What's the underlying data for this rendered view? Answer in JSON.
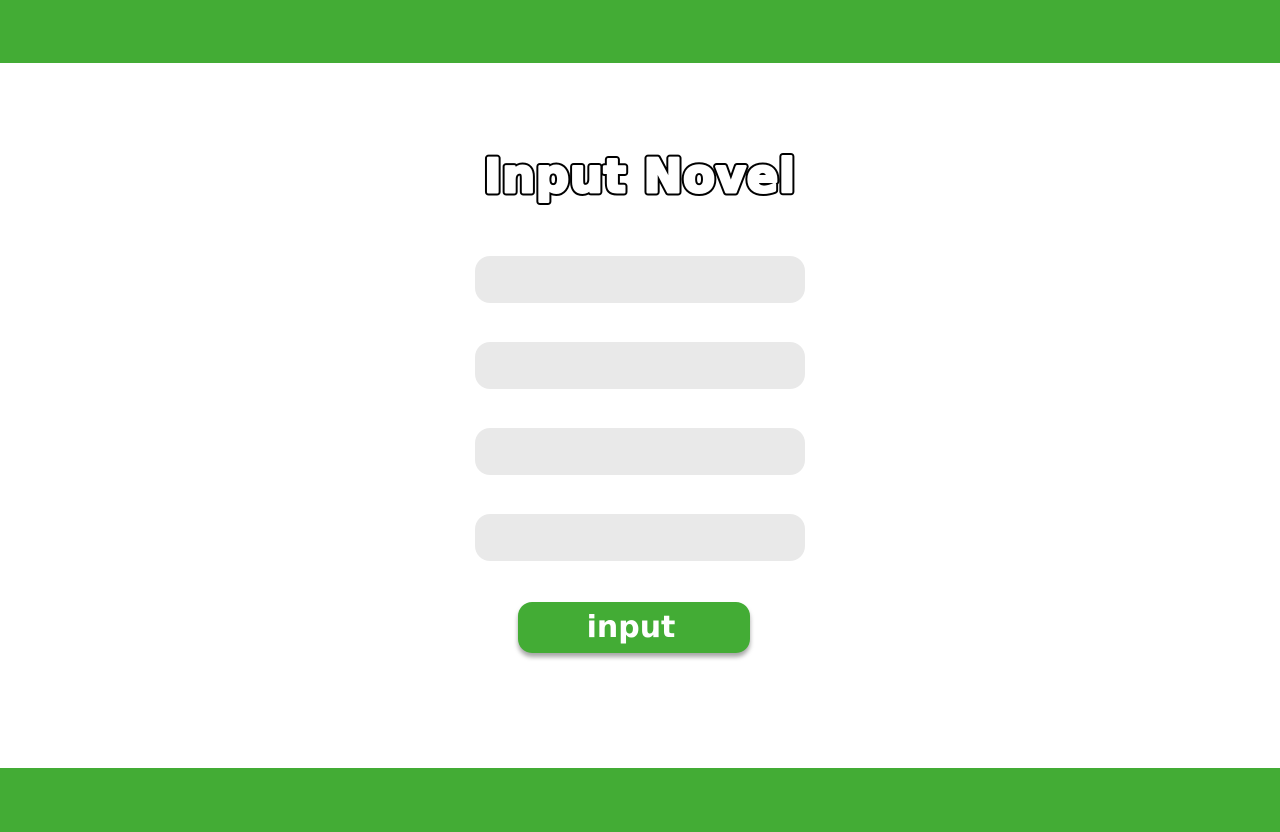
{
  "header": {
    "color": "#43ac35"
  },
  "footer": {
    "color": "#43ac35"
  },
  "form": {
    "title": "Input Novel",
    "fields": [
      {
        "value": "",
        "placeholder": ""
      },
      {
        "value": "",
        "placeholder": ""
      },
      {
        "value": "",
        "placeholder": ""
      },
      {
        "value": "",
        "placeholder": ""
      }
    ],
    "submit_label": "input"
  }
}
